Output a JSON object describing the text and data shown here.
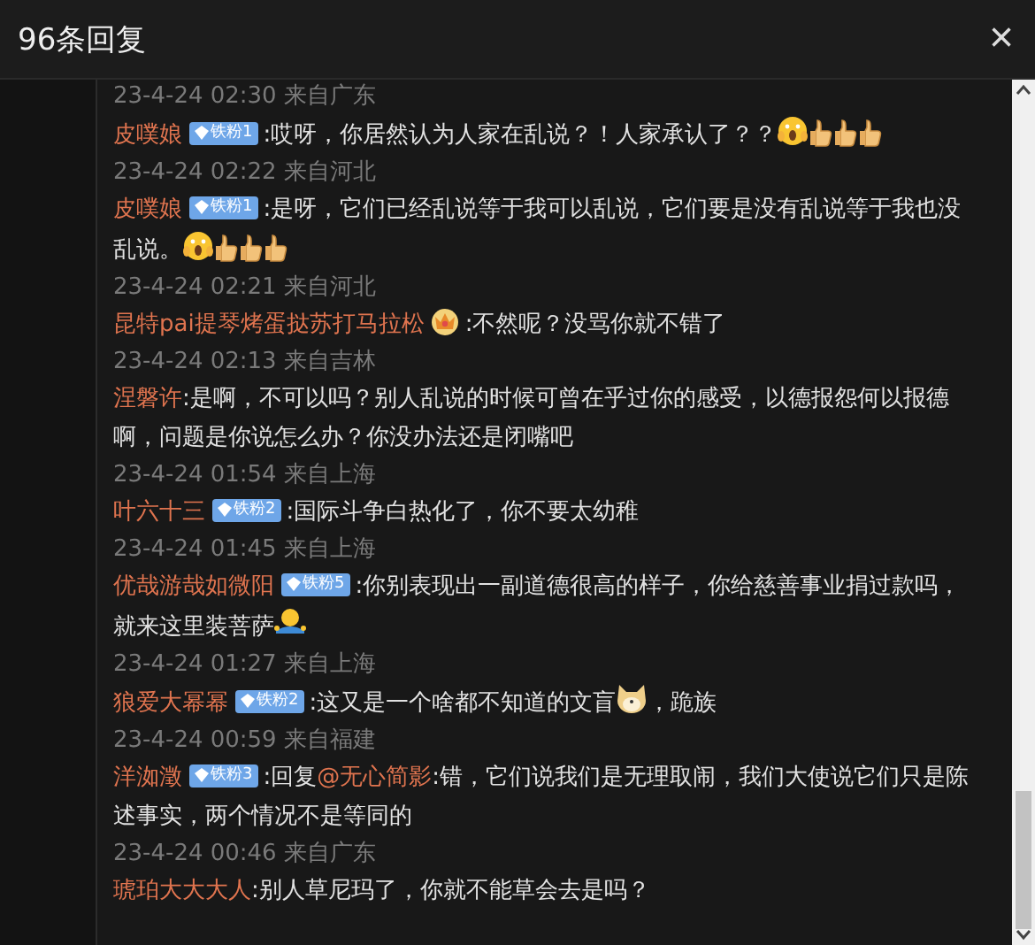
{
  "header": {
    "title": "96条回复",
    "close": "×"
  },
  "comments": [
    {
      "time": "23-4-24 02:30",
      "location": "来自广东",
      "user": "皮噗娘",
      "badge": {
        "kind": "fan",
        "label": "铁粉1"
      },
      "parts": [
        {
          "kind": "text",
          "text": ":哎呀，你居然认为人家在乱说？！人家承认了？？"
        },
        {
          "kind": "scream"
        },
        {
          "kind": "thumbs"
        },
        {
          "kind": "thumbs"
        },
        {
          "kind": "thumbs"
        }
      ]
    },
    {
      "time": "23-4-24 02:22",
      "location": "来自河北",
      "user": "皮噗娘",
      "badge": {
        "kind": "fan",
        "label": "铁粉1"
      },
      "parts": [
        {
          "kind": "text",
          "text": ":是呀，它们已经乱说等于我可以乱说，它们要是没有乱说等于我也没乱说。"
        },
        {
          "kind": "scream"
        },
        {
          "kind": "thumbs"
        },
        {
          "kind": "thumbs"
        },
        {
          "kind": "thumbs"
        }
      ]
    },
    {
      "time": "23-4-24 02:21",
      "location": "来自河北",
      "user": "昆特pai提琴烤蛋挞苏打马拉松",
      "badge": {
        "kind": "crown"
      },
      "parts": [
        {
          "kind": "text",
          "text": ":不然呢？没骂你就不错了"
        }
      ]
    },
    {
      "time": "23-4-24 02:13",
      "location": "来自吉林",
      "user": "涅磐许",
      "parts": [
        {
          "kind": "text",
          "text": ":是啊，不可以吗？别人乱说的时候可曾在乎过你的感受，以德报怨何以报德啊，问题是你说怎么办？你没办法还是闭嘴吧"
        }
      ]
    },
    {
      "time": "23-4-24 01:54",
      "location": "来自上海",
      "user": "叶六十三",
      "badge": {
        "kind": "fan",
        "label": "铁粉2"
      },
      "parts": [
        {
          "kind": "text",
          "text": ":国际斗争白热化了，你不要太幼稚"
        }
      ]
    },
    {
      "time": "23-4-24 01:45",
      "location": "来自上海",
      "user": "优哉游哉如微阳",
      "badge": {
        "kind": "fan",
        "label": "铁粉5"
      },
      "parts": [
        {
          "kind": "text",
          "text": ":你别表现出一副道德很高的样子，你给慈善事业捐过款吗，就来这里装菩萨"
        },
        {
          "kind": "shrug"
        }
      ]
    },
    {
      "time": "23-4-24 01:27",
      "location": "来自上海",
      "user": "狼爱大幂幂",
      "badge": {
        "kind": "fan",
        "label": "铁粉2"
      },
      "parts": [
        {
          "kind": "text",
          "text": ":这又是一个啥都不知道的文盲"
        },
        {
          "kind": "doge"
        },
        {
          "kind": "text",
          "text": "，跪族"
        }
      ]
    },
    {
      "time": "23-4-24 00:59",
      "location": "来自福建",
      "user": "洋洳澂",
      "badge": {
        "kind": "fan",
        "label": "铁粉3"
      },
      "parts": [
        {
          "kind": "text",
          "text": ":回复"
        },
        {
          "kind": "mention",
          "text": "@无心简影"
        },
        {
          "kind": "text",
          "text": ":错，它们说我们是无理取闹，我们大使说它们只是陈述事实，两个情况不是等同的"
        }
      ]
    },
    {
      "time": "23-4-24 00:46",
      "location": "来自广东",
      "user": "琥珀大大大人",
      "parts": [
        {
          "kind": "text",
          "text": ":别人草尼玛了，你就不能草会去是吗？"
        }
      ]
    }
  ]
}
